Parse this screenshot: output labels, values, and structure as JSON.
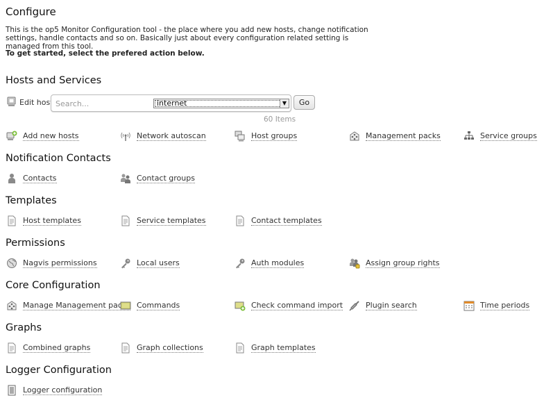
{
  "page": {
    "title": "Configure",
    "intro": "This is the op5 Monitor Configuration tool - the place where you add new hosts, change notification settings, handle contacts and so on. Basically just about every configuration related setting is managed from this tool.",
    "cta": "To get started, select the prefered action below."
  },
  "hosts_services": {
    "heading": "Hosts and Services",
    "edit_label": "Edit host",
    "search_placeholder": "Search...",
    "select_value": "internet",
    "go_label": "Go",
    "item_count": "60 Items",
    "links": [
      {
        "label": "Add new hosts",
        "icon": "add-host-icon"
      },
      {
        "label": "Network autoscan",
        "icon": "network-scan-icon"
      },
      {
        "label": "Host groups",
        "icon": "host-groups-icon"
      },
      {
        "label": "Management packs",
        "icon": "management-pack-icon"
      },
      {
        "label": "Service groups",
        "icon": "service-groups-icon"
      }
    ]
  },
  "notification_contacts": {
    "heading": "Notification Contacts",
    "links": [
      {
        "label": "Contacts",
        "icon": "contact-icon"
      },
      {
        "label": "Contact groups",
        "icon": "contact-groups-icon"
      }
    ]
  },
  "templates": {
    "heading": "Templates",
    "links": [
      {
        "label": "Host templates",
        "icon": "document-icon"
      },
      {
        "label": "Service templates",
        "icon": "document-icon"
      },
      {
        "label": "Contact templates",
        "icon": "document-icon"
      }
    ]
  },
  "permissions": {
    "heading": "Permissions",
    "links": [
      {
        "label": "Nagvis permissions",
        "icon": "globe-icon"
      },
      {
        "label": "Local users",
        "icon": "key-icon"
      },
      {
        "label": "Auth modules",
        "icon": "key-icon"
      },
      {
        "label": "Assign group rights",
        "icon": "group-rights-icon"
      }
    ]
  },
  "core_configuration": {
    "heading": "Core Configuration",
    "links": [
      {
        "label": "Manage Management packs",
        "icon": "management-pack-icon"
      },
      {
        "label": "Commands",
        "icon": "commands-icon"
      },
      {
        "label": "Check command import",
        "icon": "command-import-icon"
      },
      {
        "label": "Plugin search",
        "icon": "plugin-search-icon"
      },
      {
        "label": "Time periods",
        "icon": "calendar-icon"
      }
    ]
  },
  "graphs": {
    "heading": "Graphs",
    "links": [
      {
        "label": "Combined graphs",
        "icon": "document-icon"
      },
      {
        "label": "Graph collections",
        "icon": "document-icon"
      },
      {
        "label": "Graph templates",
        "icon": "document-icon"
      }
    ]
  },
  "logger_configuration": {
    "heading": "Logger Configuration",
    "links": [
      {
        "label": "Logger configuration",
        "icon": "logger-document-icon"
      }
    ]
  },
  "colors": {
    "link_text": "#333333",
    "heading_text": "#111111",
    "icon_gray": "#8a8a8a",
    "icon_green": "#7cbf3a",
    "icon_orange": "#e08a2a"
  }
}
